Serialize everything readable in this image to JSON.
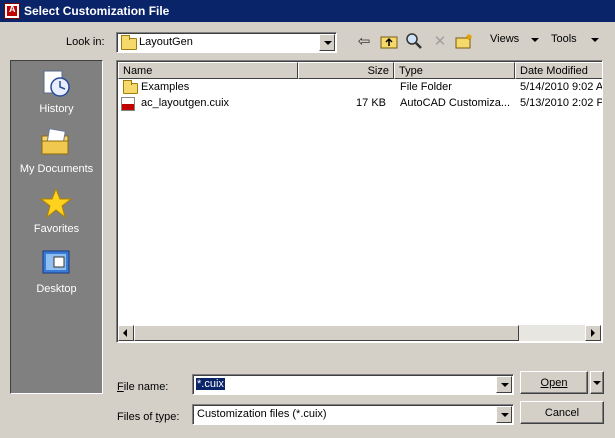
{
  "window": {
    "title": "Select Customization File"
  },
  "lookin": {
    "label": "Look in:",
    "value": "LayoutGen"
  },
  "toolbar": {
    "views_label": "Views",
    "tools_label": "Tools"
  },
  "places": [
    {
      "label": "History",
      "icon": "history-icon"
    },
    {
      "label": "My Documents",
      "icon": "my-documents-icon"
    },
    {
      "label": "Favorites",
      "icon": "favorites-icon"
    },
    {
      "label": "Desktop",
      "icon": "desktop-icon"
    }
  ],
  "filelist": {
    "columns": [
      "Name",
      "Size",
      "Type",
      "Date Modified"
    ],
    "rows": [
      {
        "name": "Examples",
        "size": "",
        "type": "File Folder",
        "date": "5/14/2010 9:02 A",
        "icon": "folder-icon"
      },
      {
        "name": "ac_layoutgen.cuix",
        "size": "17 KB",
        "type": "AutoCAD Customiza...",
        "date": "5/13/2010 2:02 P",
        "icon": "cuix-file-icon"
      }
    ]
  },
  "filename": {
    "label": "File name:",
    "value": "*.cuix"
  },
  "filetype": {
    "label": "Files of type:",
    "value": "Customization files (*.cuix)"
  },
  "buttons": {
    "open": "Open",
    "cancel": "Cancel"
  }
}
